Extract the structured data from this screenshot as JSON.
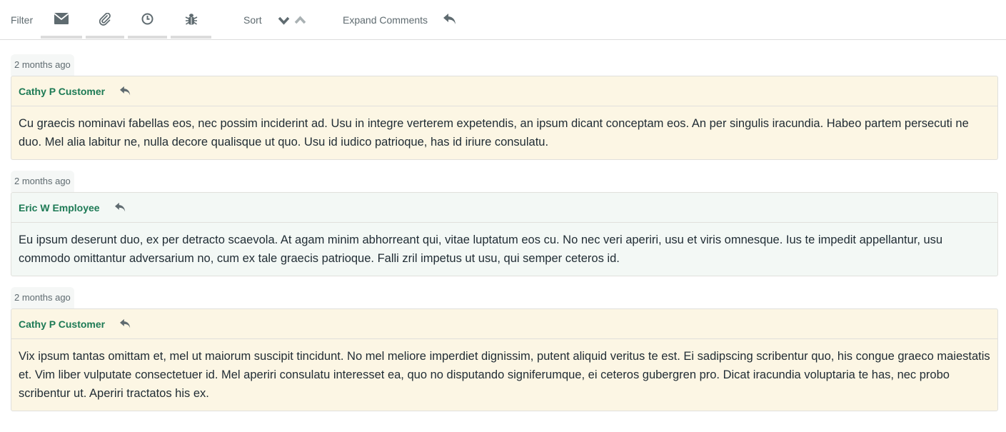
{
  "toolbar": {
    "filter_label": "Filter",
    "filters": [
      {
        "name": "email",
        "icon": "envelope-icon"
      },
      {
        "name": "attachments",
        "icon": "paperclip-icon"
      },
      {
        "name": "time",
        "icon": "clock-icon"
      },
      {
        "name": "bugs",
        "icon": "bug-icon"
      }
    ],
    "sort_label": "Sort",
    "sort_desc_icon": "chevron-down-icon",
    "sort_asc_icon": "chevron-up-icon",
    "expand_label": "Expand Comments",
    "reply_icon": "reply-icon"
  },
  "colors": {
    "author": "#1d7a55",
    "customer_bg": "#fcf6e4",
    "employee_bg": "#f3f8f5",
    "icon": "#5f6b70"
  },
  "comments": [
    {
      "timestamp": "2 months ago",
      "author": "Cathy P Customer",
      "role": "customer",
      "body": "Cu graecis nominavi fabellas eos, nec possim inciderint ad. Usu in integre verterem expetendis, an ipsum dicant conceptam eos. An per singulis iracundia. Habeo partem persecuti ne duo. Mel alia labitur ne, nulla decore qualisque ut quo. Usu id iudico patrioque, has id iriure consulatu."
    },
    {
      "timestamp": "2 months ago",
      "author": "Eric W Employee",
      "role": "employee",
      "body": "Eu ipsum deserunt duo, ex per detracto scaevola. At agam minim abhorreant qui, vitae luptatum eos cu. No nec veri aperiri, usu et viris omnesque. Ius te impedit appellantur, usu commodo omittantur adversarium no, cum ex tale graecis patrioque. Falli zril impetus ut usu, qui semper ceteros id."
    },
    {
      "timestamp": "2 months ago",
      "author": "Cathy P Customer",
      "role": "customer",
      "body": "Vix ipsum tantas omittam et, mel ut maiorum suscipit tincidunt. No mel meliore imperdiet dignissim, putent aliquid veritus te est. Ei sadipscing scribentur quo, his congue graeco maiestatis et. Vim liber vulputate consectetuer id. Mel aperiri consulatu interesset ea, quo no disputando signiferumque, ei ceteros gubergren pro. Dicat iracundia voluptaria te has, nec probo scribentur ut. Aperiri tractatos his ex."
    }
  ]
}
